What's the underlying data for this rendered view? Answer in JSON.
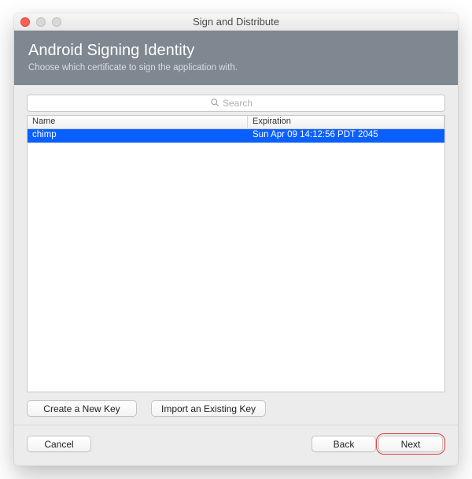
{
  "window": {
    "title": "Sign and Distribute"
  },
  "header": {
    "title": "Android Signing Identity",
    "subtitle": "Choose which certificate to sign the application with."
  },
  "search": {
    "placeholder": "Search",
    "value": ""
  },
  "table": {
    "columns": {
      "name": "Name",
      "expiration": "Expiration"
    },
    "rows": [
      {
        "name": "chimp",
        "expiration": "Sun Apr 09 14:12:56 PDT 2045",
        "selected": true
      }
    ]
  },
  "keyButtons": {
    "createNew": "Create a New Key",
    "importExisting": "Import an Existing Key"
  },
  "footer": {
    "cancel": "Cancel",
    "back": "Back",
    "next": "Next"
  }
}
